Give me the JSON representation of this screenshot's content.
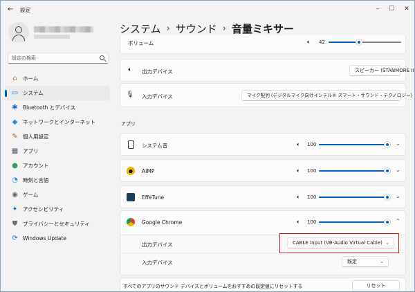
{
  "window": {
    "title": "設定",
    "back_glyph": "←",
    "min_glyph": "–",
    "max_glyph": "☐",
    "close_glyph": "✕"
  },
  "search": {
    "placeholder": "設定の検索"
  },
  "sidebar": {
    "items": [
      {
        "label": "ホーム",
        "icon": "home-icon",
        "glyph": "⌂",
        "color": "#d36b3a"
      },
      {
        "label": "システム",
        "icon": "system-icon",
        "glyph": "▭",
        "color": "#1c7cd5",
        "active": true
      },
      {
        "label": "Bluetooth とデバイス",
        "icon": "bluetooth-icon",
        "glyph": "✱",
        "color": "#1a6fd0"
      },
      {
        "label": "ネットワークとインターネット",
        "icon": "network-icon",
        "glyph": "◆",
        "color": "#2a8bd8"
      },
      {
        "label": "個人用設定",
        "icon": "personalization-icon",
        "glyph": "✎",
        "color": "#b15a2a"
      },
      {
        "label": "アプリ",
        "icon": "apps-icon",
        "glyph": "▦",
        "color": "#556070"
      },
      {
        "label": "アカウント",
        "icon": "accounts-icon",
        "glyph": "●",
        "color": "#2aa05a"
      },
      {
        "label": "時刻と言語",
        "icon": "time-language-icon",
        "glyph": "◔",
        "color": "#2277c9"
      },
      {
        "label": "ゲーム",
        "icon": "gaming-icon",
        "glyph": "◉",
        "color": "#5a6672"
      },
      {
        "label": "アクセシビリティ",
        "icon": "accessibility-icon",
        "glyph": "✦",
        "color": "#1a6fd0"
      },
      {
        "label": "プライバシーとセキュリティ",
        "icon": "privacy-shield-icon",
        "glyph": "⛊",
        "color": "#6b7480"
      },
      {
        "label": "Windows Update",
        "icon": "windows-update-icon",
        "glyph": "⟳",
        "color": "#1a6fd0"
      }
    ]
  },
  "breadcrumb": {
    "part1": "システム",
    "sep1": "›",
    "part2": "サウンド",
    "sep2": "›",
    "current": "音量ミキサー"
  },
  "system": {
    "volume_label": "ボリューム",
    "volume_value": "42",
    "volume_fraction": 0.42,
    "output_label": "出力デバイス",
    "output_value": "スピーカー (STANMORE II)",
    "input_label": "入力デバイス",
    "input_value": "マイク配列 (デジタルマイク向けインテル® スマート・サウンド・テクノロジー)"
  },
  "apps_section": {
    "label": "アプリ"
  },
  "apps": [
    {
      "name": "システム音",
      "volume": "100",
      "chevron": "⌄",
      "icon": "system-sounds-icon"
    },
    {
      "name": "AIMP",
      "volume": "100",
      "chevron": "⌄",
      "icon": "aimp-icon"
    },
    {
      "name": "EffeTune",
      "volume": "100",
      "chevron": "⌄",
      "icon": "effetune-icon"
    },
    {
      "name": "Google Chrome",
      "volume": "100",
      "chevron": "⌃",
      "icon": "chrome-icon"
    }
  ],
  "chrome_expanded": {
    "output_label": "出力デバイス",
    "output_value": "CABLE Input (VB-Audio Virtual Cable)",
    "input_label": "入力デバイス",
    "input_value": "既定"
  },
  "reset": {
    "label": "すべてのアプリのサウンド デバイスとボリュームをおすすめの既定値にリセットする",
    "button": "リセット"
  },
  "glyphs": {
    "speaker": "🔈︎",
    "chevron_down": "⌄",
    "mic": "🎙︎"
  },
  "colors": {
    "accent": "#005fb8",
    "highlight": "#e0161c"
  }
}
